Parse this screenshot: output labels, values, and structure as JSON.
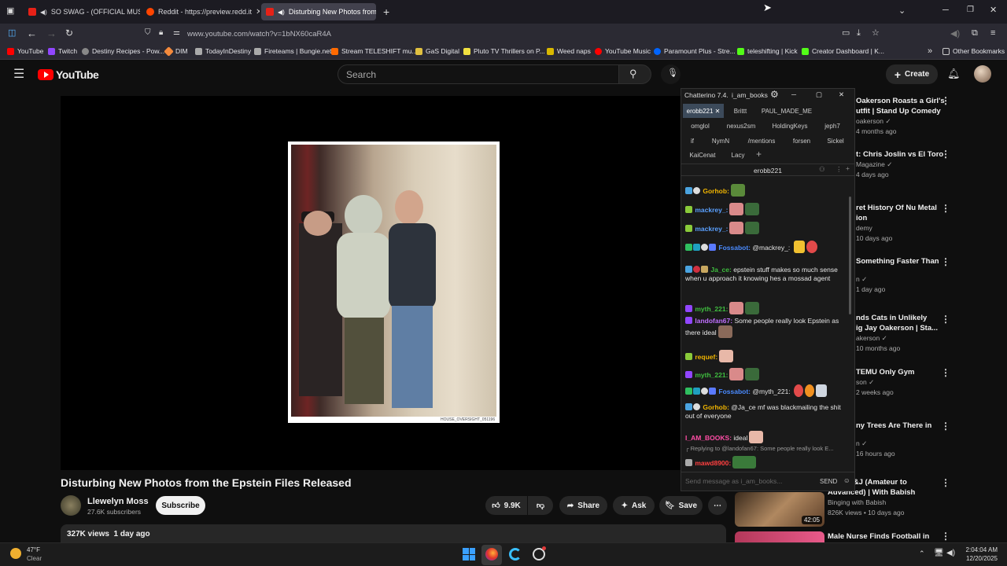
{
  "browser": {
    "tabs": [
      {
        "label": "SO SWAG - (OFFICIAL MUS",
        "fav": "#e62117"
      },
      {
        "label": "Reddit - https://preview.redd.it",
        "fav": "#ff4500"
      },
      {
        "label": "Disturbing New Photos from",
        "fav": "#e62117"
      }
    ],
    "url": "www.youtube.com/watch?v=1bNX60caR4A",
    "bookmarks": [
      {
        "label": "YouTube",
        "color": "#ff0000"
      },
      {
        "label": "Twitch",
        "color": "#9146ff"
      },
      {
        "label": "Destiny Recipes - Pow...",
        "color": "#888888"
      },
      {
        "label": "DIM",
        "color": "#f58a3c"
      },
      {
        "label": "TodayInDestiny",
        "color": "#aaaaaa"
      },
      {
        "label": "Fireteams | Bungie.net",
        "color": "#aaaaaa"
      },
      {
        "label": "Stream TELESHIFT mu...",
        "color": "#ff6a00"
      },
      {
        "label": "GaS Digital",
        "color": "#e0c040"
      },
      {
        "label": "Pluto TV Thrillers on P...",
        "color": "#f0e040"
      },
      {
        "label": "Weed naps",
        "color": "#d9b800"
      },
      {
        "label": "YouTube Music",
        "color": "#ff0000"
      },
      {
        "label": "Paramount Plus - Stre...",
        "color": "#0064ff"
      },
      {
        "label": "teleshifting | Kick",
        "color": "#53fc18"
      },
      {
        "label": "Creator Dashboard | K...",
        "color": "#53fc18"
      }
    ],
    "other_bookmarks": "Other Bookmarks"
  },
  "youtube": {
    "logo": "YouTube",
    "search_placeholder": "Search",
    "create": "Create",
    "video_title": "Disturbing New Photos from the Epstein Files Released",
    "channel": "Llewelyn Moss",
    "subscribers": "27.6K subscribers",
    "subscribe": "Subscribe",
    "likes": "9.9K",
    "share": "Share",
    "ask": "Ask",
    "save": "Save",
    "views": "327K views",
    "age": "1 day ago",
    "photo_caption": "HOUSE_OVERSIGHT_051196",
    "recommendations": [
      {
        "title1": "Oakerson Roasts a Girl's",
        "title2": "utfit | Stand Up Comedy",
        "meta1": "oakerson ✓",
        "meta2": "4 months ago"
      },
      {
        "title1": "t: Chris Joslin vs El Toro",
        "title2": "",
        "meta1": "Magazine ✓",
        "meta2": "4 days ago"
      },
      {
        "title1": "ret History Of Nu Metal",
        "title2": "ion",
        "meta1": "demy",
        "meta2": "10 days ago"
      },
      {
        "title1": "Something Faster Than",
        "title2": "",
        "meta1": "n ✓",
        "meta2": "1 day ago"
      },
      {
        "title1": "nds Cats in Unlikely",
        "title2": "ig Jay Oakerson | Sta...",
        "meta1": "akerson ✓",
        "meta2": "10 months ago"
      },
      {
        "title1": "TEMU Only Gym",
        "title2": "",
        "meta1": "son ✓",
        "meta2": "2 weeks ago"
      },
      {
        "title1": "ny Trees Are There in",
        "title2": "",
        "meta1": "n ✓",
        "meta2": "16 hours ago"
      },
      {
        "title1": "s of PB&J (Amateur to",
        "title2": "Advanced) | With Babish",
        "meta1": "Binging with Babish",
        "meta2": "826K views • 10 days ago"
      }
    ],
    "last_rec": "Male Nurse Finds Football in",
    "thumb_duration": "42:05"
  },
  "chatterino": {
    "title": "Chatterino 7.4.",
    "user": "i_am_books",
    "tabs_row1": [
      "erobb221",
      "Brittt",
      "PAUL_MADE_ME"
    ],
    "tabs_row2": [
      "omglol",
      "nexus2sm",
      "HoldingKeys",
      "jeph7"
    ],
    "tabs_row3": [
      "if",
      "NymN",
      "/mentions",
      "forsen",
      "Sickel"
    ],
    "tabs_row4": [
      "KaiCenat",
      "Lacy"
    ],
    "channel": "erobb221",
    "messages": [
      {
        "user": "Gorhob:",
        "color": "#f0b400",
        "text": ""
      },
      {
        "user": "mackrey_:",
        "color": "#5aa0ff",
        "text": ""
      },
      {
        "user": "mackrey_:",
        "color": "#5aa0ff",
        "text": ""
      },
      {
        "user": "Fossabot:",
        "color": "#4a8bff",
        "text": "@mackrey_"
      },
      {
        "user": "Ja_ce:",
        "color": "#3fbf3f",
        "text": "epstein stuff makes so much sense when u approach it knowing hes a mossad agent"
      },
      {
        "user": "myth_221:",
        "color": "#3fbf3f",
        "text": ""
      },
      {
        "user": "landofan67:",
        "color": "#c070ff",
        "text": "Some people really look Epstein as there ideal"
      },
      {
        "user": "requef:",
        "color": "#f0b400",
        "text": ""
      },
      {
        "user": "myth_221:",
        "color": "#3fbf3f",
        "text": ""
      },
      {
        "user": "Fossabot:",
        "color": "#4a8bff",
        "text": "@myth_221"
      },
      {
        "user": "Gorhob:",
        "color": "#f0b400",
        "text": "@Ja_ce mf was blackmailing the shit out of everyone"
      },
      {
        "user": "I_AM_BOOKS:",
        "color": "#ff4da6",
        "text": "ideal"
      },
      {
        "user": "mawd8900:",
        "color": "#ff4040",
        "text": ""
      }
    ],
    "reply": "Replying to @landofan67: Some people really look E...",
    "input_placeholder": "Send message as i_am_books...",
    "send": "SEND"
  },
  "taskbar": {
    "temp": "47°F",
    "weather": "Clear",
    "time": "2:04:04 AM",
    "date": "12/20/2025"
  }
}
